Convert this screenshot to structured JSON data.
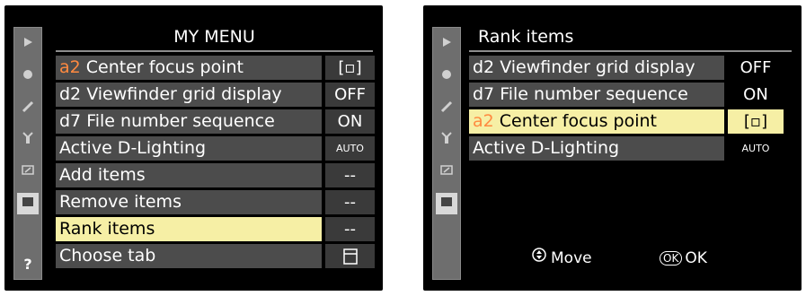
{
  "left": {
    "title": "MY MENU",
    "tabs": [
      "playback-icon",
      "camera-icon",
      "pencil-icon",
      "wrench-icon",
      "retouch-icon",
      "mymenu-icon",
      "help-icon"
    ],
    "help_label": "?",
    "items": [
      {
        "code": "a2",
        "label": " Center focus point",
        "value": "[▫]",
        "selected": false
      },
      {
        "code": "",
        "label": "d2 Viewfinder grid display",
        "value": "OFF",
        "selected": false
      },
      {
        "code": "",
        "label": "d7 File number sequence",
        "value": "ON",
        "selected": false
      },
      {
        "code": "",
        "label": "Active D-Lighting",
        "value": "AUTO",
        "selected": false
      },
      {
        "code": "",
        "label": "Add items",
        "value": "--",
        "selected": false
      },
      {
        "code": "",
        "label": "Remove items",
        "value": "--",
        "selected": false
      },
      {
        "code": "",
        "label": "Rank items",
        "value": "--",
        "selected": true
      },
      {
        "code": "",
        "label": "Choose tab",
        "value": "",
        "selected": false
      }
    ]
  },
  "right": {
    "title": "Rank items",
    "items": [
      {
        "code": "",
        "label": "d2 Viewfinder grid display",
        "value": "OFF",
        "selected": false
      },
      {
        "code": "",
        "label": "d7 File number sequence",
        "value": "ON",
        "selected": false
      },
      {
        "code": "a2",
        "label": " Center focus point",
        "value": "[▫]",
        "selected": true
      },
      {
        "code": "",
        "label": "Active D-Lighting",
        "value": "AUTO",
        "selected": false
      }
    ],
    "footer": {
      "move_label": "Move",
      "ok_label": "OK",
      "ok_badge": "OK"
    }
  }
}
